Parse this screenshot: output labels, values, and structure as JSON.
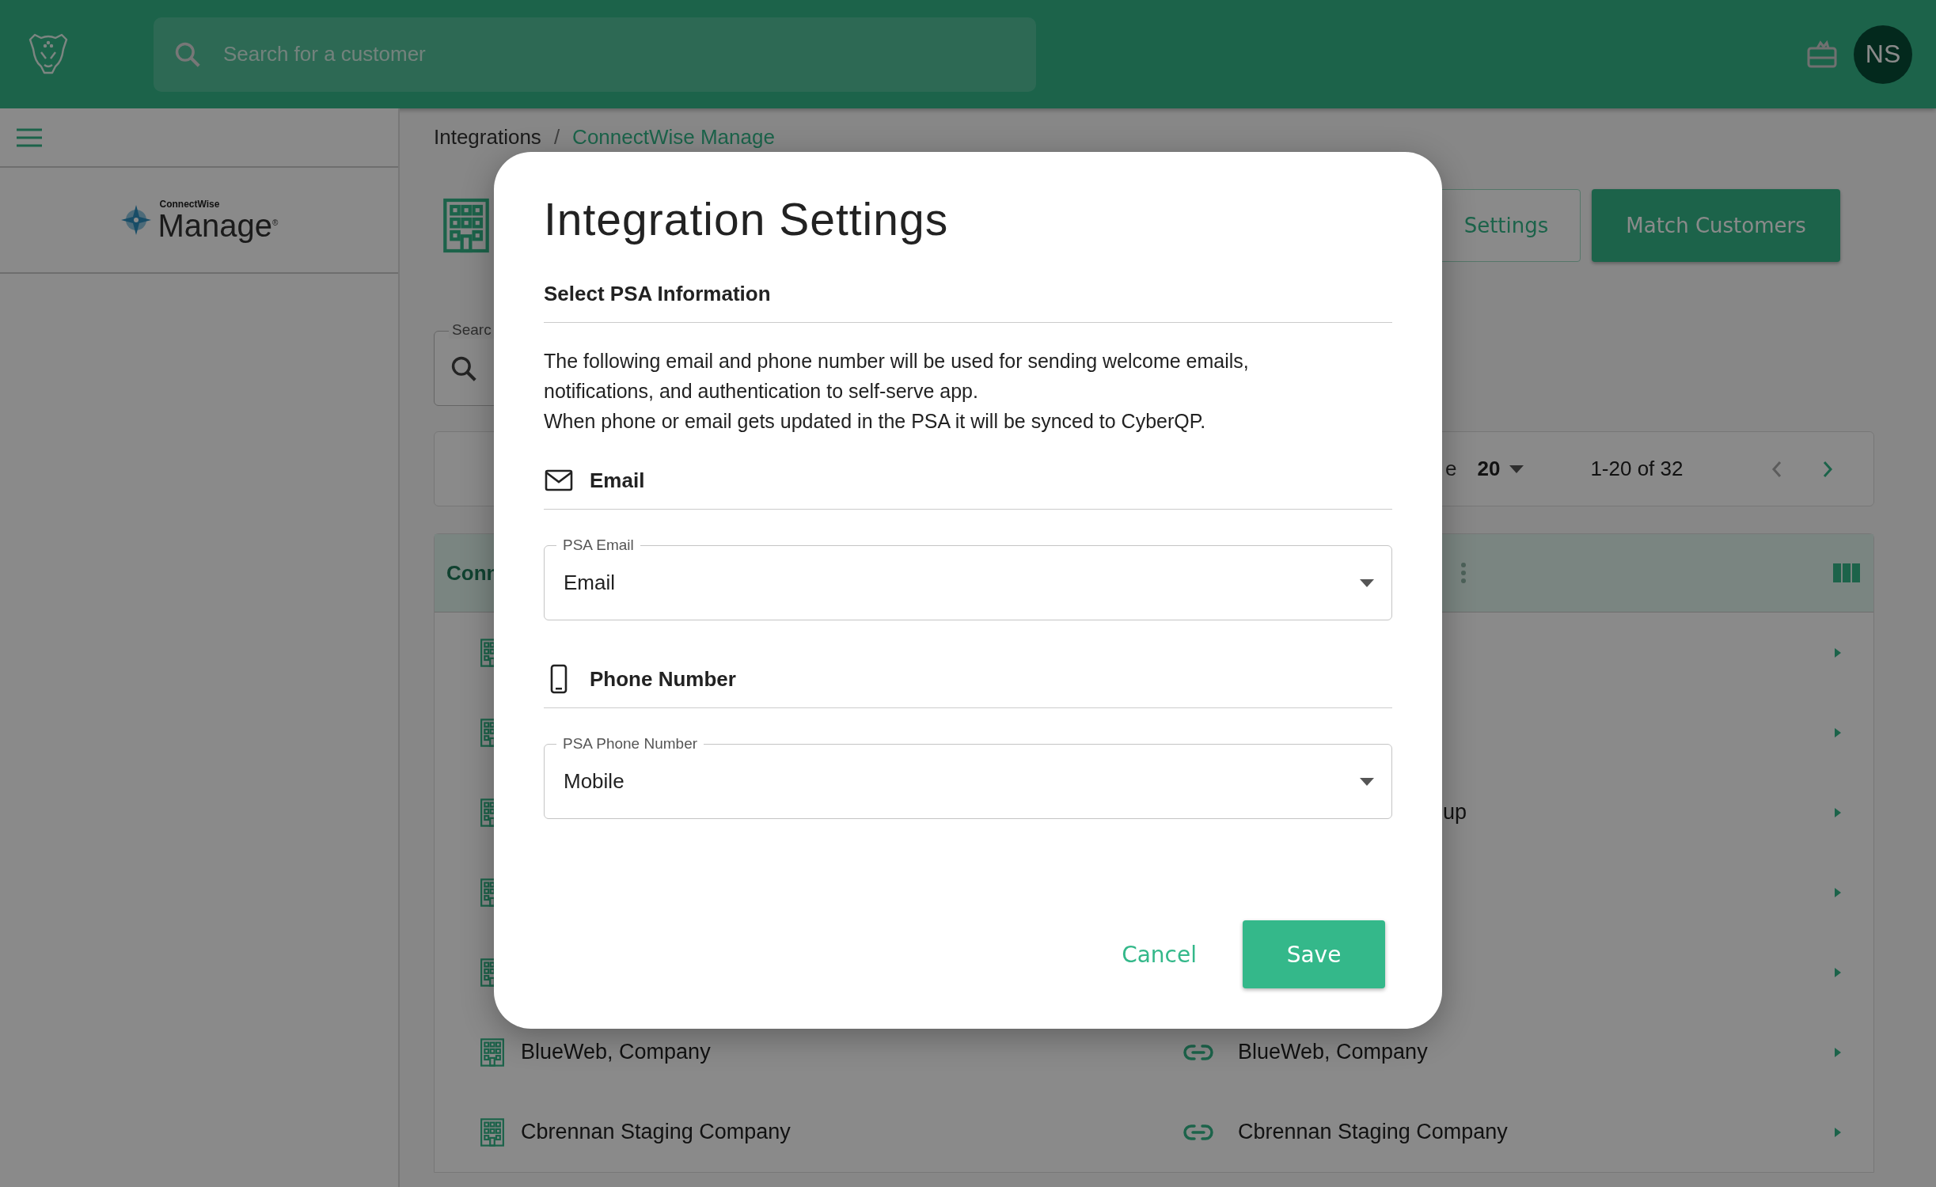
{
  "header": {
    "search": {
      "placeholder": "Search for a customer"
    },
    "avatar": {
      "initials": "NS"
    }
  },
  "sidebar": {
    "logo": {
      "brand": "ConnectWise",
      "product": "Manage$^{®}$"
    }
  },
  "breadcrumb": {
    "separator": "/",
    "items": [
      {
        "label": "Integrations"
      },
      {
        "label": "ConnectWise Manage"
      }
    ]
  },
  "actions": [
    {
      "label": "Settings",
      "kind": "outlined"
    },
    {
      "label": "Match Customers",
      "kind": "filled"
    }
  ],
  "search_field": {
    "label": "Searc"
  },
  "pagination": {
    "page_size_label": "e",
    "page_size": "20",
    "range": "1-20 of 32",
    "prev_disabled": true,
    "next_disabled": false
  },
  "table": {
    "header": "Conn",
    "rows": [
      {
        "kind": "covered"
      },
      {
        "kind": "covered"
      },
      {
        "kind": "partial",
        "right": "up"
      },
      {
        "kind": "covered"
      },
      {
        "kind": "covered"
      },
      {
        "kind": "matched",
        "left": "BlueWeb, Company",
        "right": "BlueWeb, Company"
      },
      {
        "kind": "matched",
        "left": "Cbrennan Staging Company",
        "right": "Cbrennan Staging Company"
      }
    ]
  },
  "modal": {
    "title": "Integration Settings",
    "subtitle": "Select PSA Information",
    "paragraphs": [
      "The following email and phone number will be used for sending welcome emails, notifications, and authentication to self-serve app.",
      "When phone or email gets updated in the PSA it will be synced to CyberQP."
    ],
    "sections": [
      {
        "kind": "email",
        "heading": "Email",
        "field_label": "PSA Email",
        "value": "Email"
      },
      {
        "kind": "phone",
        "heading": "Phone Number",
        "field_label": "PSA Phone Number",
        "value": "Mobile"
      }
    ],
    "buttons": [
      {
        "label": "Cancel",
        "kind": "text"
      },
      {
        "label": "Save",
        "kind": "primary"
      }
    ]
  }
}
